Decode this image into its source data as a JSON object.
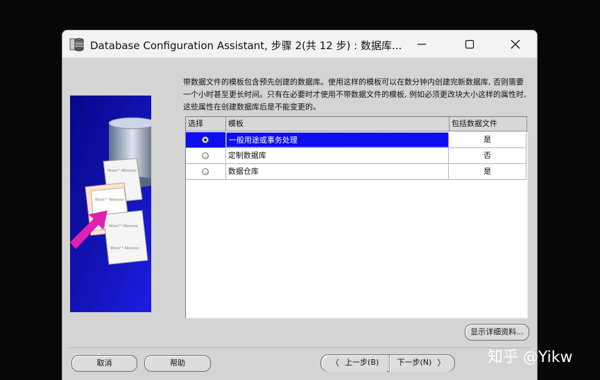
{
  "window": {
    "title": "Database Configuration Assistant, 步骤 2(共 12 步) : 数据库..."
  },
  "description": "带数据文件的模板包含预先创建的数据库。使用这样的模板可以在数分钟内创建完新数据库, 否则需要一个小时甚至更长时间。只有在必要时才使用不带数据文件的模板, 例如必须更改块大小这样的属性时, 这些属性在创建数据库后是不能变更的。",
  "side_image": {
    "page_lines": [
      "Wxxx°° Abxxxxx",
      "Wxxx°° Abxxxxx",
      "Wxxx°° Abxxxxx",
      "Wxxx°° Abxxxxx"
    ]
  },
  "table": {
    "headers": [
      "选择",
      "模板",
      "包括数据文件"
    ],
    "rows": [
      {
        "name": "一般用途或事务处理",
        "includes": "是",
        "selected": true
      },
      {
        "name": "定制数据库",
        "includes": "否",
        "selected": false
      },
      {
        "name": "数据仓库",
        "includes": "是",
        "selected": false
      }
    ]
  },
  "buttons": {
    "details": "显示详细资料...",
    "cancel": "取消",
    "help": "帮助",
    "back": "上一步(B)",
    "next": "下一步(N)"
  },
  "watermark": "知乎 @Yikw",
  "colors": {
    "selection": "#0d0df0",
    "dialog_bg": "#d4d4d4",
    "image_bg": "#0a0ad0",
    "arrow": "#e020b0"
  }
}
